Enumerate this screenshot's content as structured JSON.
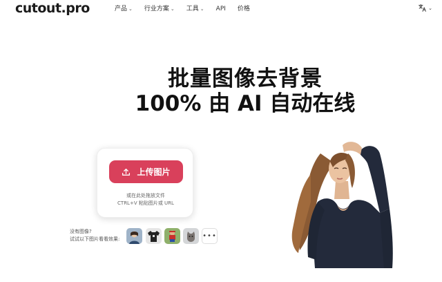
{
  "header": {
    "logo": "cutout.pro",
    "nav": [
      {
        "label": "产品",
        "has_dropdown": true
      },
      {
        "label": "行业方案",
        "has_dropdown": true
      },
      {
        "label": "工具",
        "has_dropdown": true
      },
      {
        "label": "API",
        "has_dropdown": false
      },
      {
        "label": "价格",
        "has_dropdown": false
      }
    ],
    "language_icon": "translate-icon"
  },
  "hero": {
    "title_line1": "批量图像去背景",
    "title_line2": "100% 由 AI 自动在线"
  },
  "upload": {
    "button_label": "上传图片",
    "button_icon": "upload-icon",
    "hint_line1": "或在此处拖放文件",
    "hint_line2": "CTRL+V 粘贴图片或 URL",
    "accent_color": "#d9405b"
  },
  "samples": {
    "line1": "没有图像?",
    "line2": "试试以下图片看看效果:",
    "thumbnails": [
      "sample-portrait",
      "sample-tshirt",
      "sample-toy",
      "sample-cat"
    ],
    "more_label": "•••"
  }
}
